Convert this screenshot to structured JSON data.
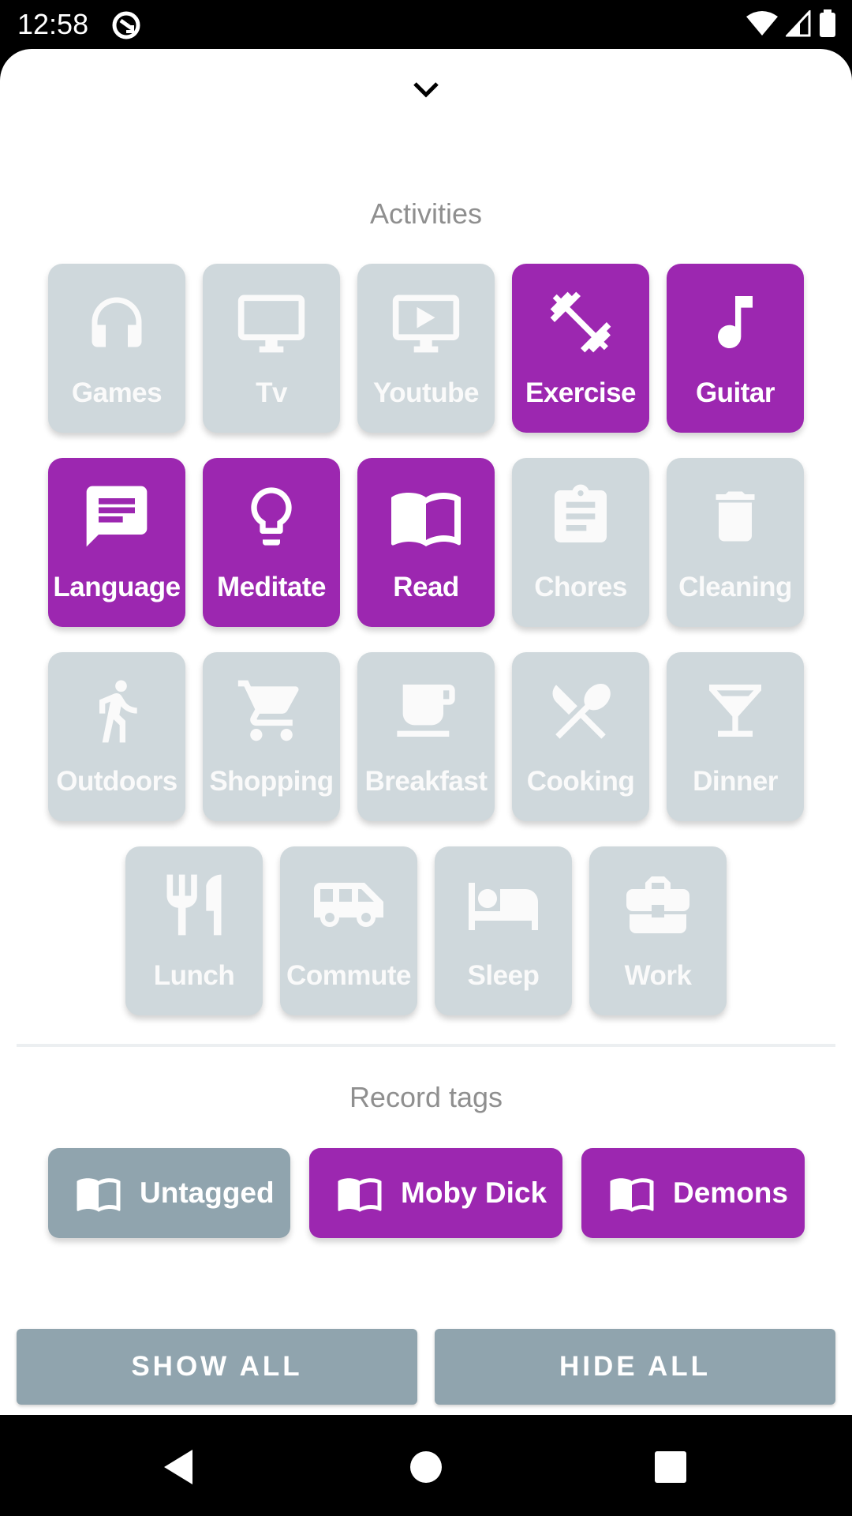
{
  "status_bar": {
    "time": "12:58"
  },
  "sections": {
    "activities_title": "Activities",
    "tags_title": "Record tags"
  },
  "activities": [
    {
      "label": "Games",
      "icon": "headphones-icon",
      "selected": false
    },
    {
      "label": "Tv",
      "icon": "monitor-icon",
      "selected": false
    },
    {
      "label": "Youtube",
      "icon": "video-play-icon",
      "selected": false
    },
    {
      "label": "Exercise",
      "icon": "dumbbell-icon",
      "selected": true
    },
    {
      "label": "Guitar",
      "icon": "music-note-icon",
      "selected": true
    },
    {
      "label": "Language",
      "icon": "message-icon",
      "selected": true
    },
    {
      "label": "Meditate",
      "icon": "lightbulb-icon",
      "selected": true
    },
    {
      "label": "Read",
      "icon": "book-icon",
      "selected": true
    },
    {
      "label": "Chores",
      "icon": "clipboard-icon",
      "selected": false
    },
    {
      "label": "Cleaning",
      "icon": "trash-icon",
      "selected": false
    },
    {
      "label": "Outdoors",
      "icon": "walking-icon",
      "selected": false
    },
    {
      "label": "Shopping",
      "icon": "cart-icon",
      "selected": false
    },
    {
      "label": "Breakfast",
      "icon": "coffee-cup-icon",
      "selected": false
    },
    {
      "label": "Cooking",
      "icon": "utensils-cross-icon",
      "selected": false
    },
    {
      "label": "Dinner",
      "icon": "cocktail-icon",
      "selected": false
    },
    {
      "label": "Lunch",
      "icon": "fork-knife-icon",
      "selected": false
    },
    {
      "label": "Commute",
      "icon": "van-icon",
      "selected": false
    },
    {
      "label": "Sleep",
      "icon": "bed-icon",
      "selected": false
    },
    {
      "label": "Work",
      "icon": "briefcase-icon",
      "selected": false
    }
  ],
  "tags": [
    {
      "label": "Untagged",
      "icon": "book-icon",
      "selected": false
    },
    {
      "label": "Moby Dick",
      "icon": "book-icon",
      "selected": true
    },
    {
      "label": "Demons",
      "icon": "book-icon",
      "selected": true
    }
  ],
  "buttons": {
    "show_all": "SHOW ALL",
    "hide_all": "HIDE ALL"
  },
  "colors": {
    "selected": "#9c27b0",
    "unselected_tile": "#cfd8dc",
    "unselected_tag": "#90a4ae",
    "button": "#90a4ae"
  }
}
